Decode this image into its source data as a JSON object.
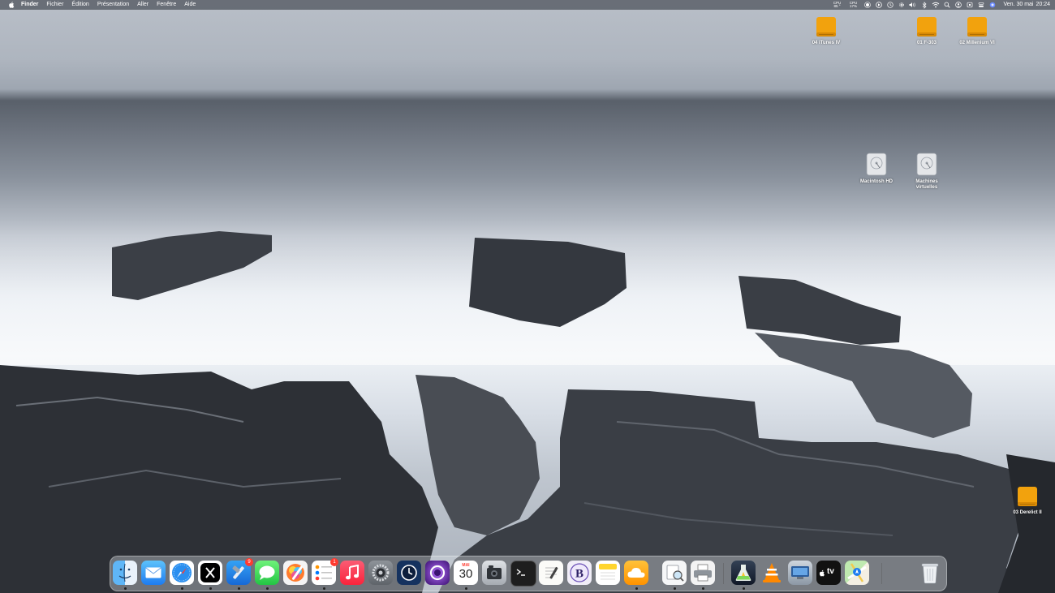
{
  "menubar": {
    "app_name": "Finder",
    "menus": [
      "Fichier",
      "Édition",
      "Présentation",
      "Aller",
      "Fenêtre",
      "Aide"
    ],
    "cpu_temp_label": "CPU",
    "cpu_temp_value": "85 °",
    "cpu_usage_label": "CPU",
    "cpu_usage_value": "17%",
    "date": "Ven. 30 mai",
    "time": "20:24"
  },
  "desktop": {
    "icons": [
      {
        "label": "04 iTunes IV",
        "type": "external-drive",
        "color": "#f2a20d"
      },
      {
        "label": "01 F-303",
        "type": "external-drive",
        "color": "#f2a20d"
      },
      {
        "label": "02 Millenium VI",
        "type": "external-drive",
        "color": "#f2a20d"
      },
      {
        "label": "Macintosh HD",
        "type": "internal-drive"
      },
      {
        "label": "Machines\nvirtuelles",
        "type": "internal-drive"
      },
      {
        "label": "03 Derelict II",
        "type": "external-drive",
        "color": "#f2a20d"
      }
    ]
  },
  "dock": {
    "apps": [
      {
        "name": "Finder",
        "icon": "finder-icon",
        "running": true
      },
      {
        "name": "Mail",
        "icon": "mail-icon",
        "running": false
      },
      {
        "name": "Safari",
        "icon": "safari-icon",
        "running": true
      },
      {
        "name": "X",
        "icon": "x-icon",
        "running": true
      },
      {
        "name": "Xcode",
        "icon": "hammer-icon",
        "badge": "9",
        "running": true
      },
      {
        "name": "Messages",
        "icon": "messages-icon",
        "running": true
      },
      {
        "name": "Pixelmator",
        "icon": "pixelmator-icon",
        "running": false
      },
      {
        "name": "Reminders",
        "icon": "reminders-icon",
        "badge": "1",
        "running": true
      },
      {
        "name": "Music",
        "icon": "music-icon",
        "running": false
      },
      {
        "name": "System Settings",
        "icon": "gear-icon",
        "running": false
      },
      {
        "name": "Time Machine",
        "icon": "time-machine-icon",
        "running": false
      },
      {
        "name": "Siri",
        "icon": "siri-icon",
        "running": false
      },
      {
        "name": "Calendar",
        "icon": "calendar-icon",
        "month": "MAI",
        "day": "30",
        "running": true
      },
      {
        "name": "Screenshot",
        "icon": "screenshot-icon",
        "running": false
      },
      {
        "name": "Terminal",
        "icon": "terminal-icon",
        "running": false
      },
      {
        "name": "TextEdit",
        "icon": "textedit-icon",
        "running": false
      },
      {
        "name": "BBEdit",
        "icon": "bbedit-icon",
        "running": false
      },
      {
        "name": "Notes",
        "icon": "notes-icon",
        "running": false
      },
      {
        "name": "iCloud",
        "icon": "cloud-icon",
        "running": true
      },
      {
        "name": "Preview",
        "icon": "preview-icon",
        "running": true
      },
      {
        "name": "Printer",
        "icon": "printer-icon",
        "running": true
      },
      {
        "name": "Console",
        "icon": "flask-icon",
        "running": true
      },
      {
        "name": "VLC",
        "icon": "vlc-icon",
        "running": false
      },
      {
        "name": "Migration",
        "icon": "migration-icon",
        "running": false
      },
      {
        "name": "Apple TV",
        "icon": "appletv-icon",
        "label": "tv",
        "running": false
      },
      {
        "name": "Maps",
        "icon": "maps-icon",
        "running": false
      },
      {
        "name": "Trash",
        "icon": "trash-icon",
        "running": false
      }
    ]
  }
}
